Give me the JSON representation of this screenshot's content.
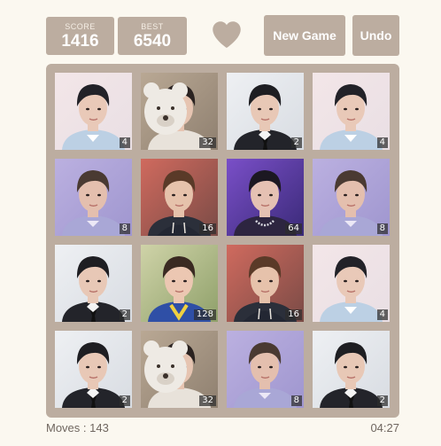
{
  "scores": {
    "score_label": "SCORE",
    "score_value": "1416",
    "best_label": "BEST",
    "best_value": "6540"
  },
  "buttons": {
    "new_game": "New Game",
    "undo": "Undo"
  },
  "icons": {
    "favorite": "heart-icon"
  },
  "colors": {
    "accent": "#bcada0",
    "background": "#fbf8f0",
    "tile_number_bg": "#2d2d2d"
  },
  "board": {
    "rows": [
      [
        {
          "value": "4",
          "image": "portrait-light-blue-background"
        },
        {
          "value": "32",
          "image": "portrait-with-white-teddy-bear"
        },
        {
          "value": "2",
          "image": "portrait-suit-and-tie"
        },
        {
          "value": "4",
          "image": "portrait-light-blue-background"
        }
      ],
      [
        {
          "value": "8",
          "image": "portrait-lilac-background"
        },
        {
          "value": "16",
          "image": "portrait-dark-hoodie"
        },
        {
          "value": "64",
          "image": "portrait-purple-chain-necklace"
        },
        {
          "value": "8",
          "image": "portrait-lilac-background"
        }
      ],
      [
        {
          "value": "2",
          "image": "portrait-suit-and-tie"
        },
        {
          "value": "128",
          "image": "portrait-winking-blue-jacket"
        },
        {
          "value": "16",
          "image": "portrait-dark-hoodie"
        },
        {
          "value": "4",
          "image": "portrait-light-blue-background"
        }
      ],
      [
        {
          "value": "2",
          "image": "portrait-suit-and-tie"
        },
        {
          "value": "32",
          "image": "portrait-with-white-teddy-bear"
        },
        {
          "value": "8",
          "image": "portrait-lilac-background"
        },
        {
          "value": "2",
          "image": "portrait-suit-and-tie"
        }
      ]
    ]
  },
  "footer": {
    "moves_text": "Moves : 143",
    "timer": "04:27"
  }
}
